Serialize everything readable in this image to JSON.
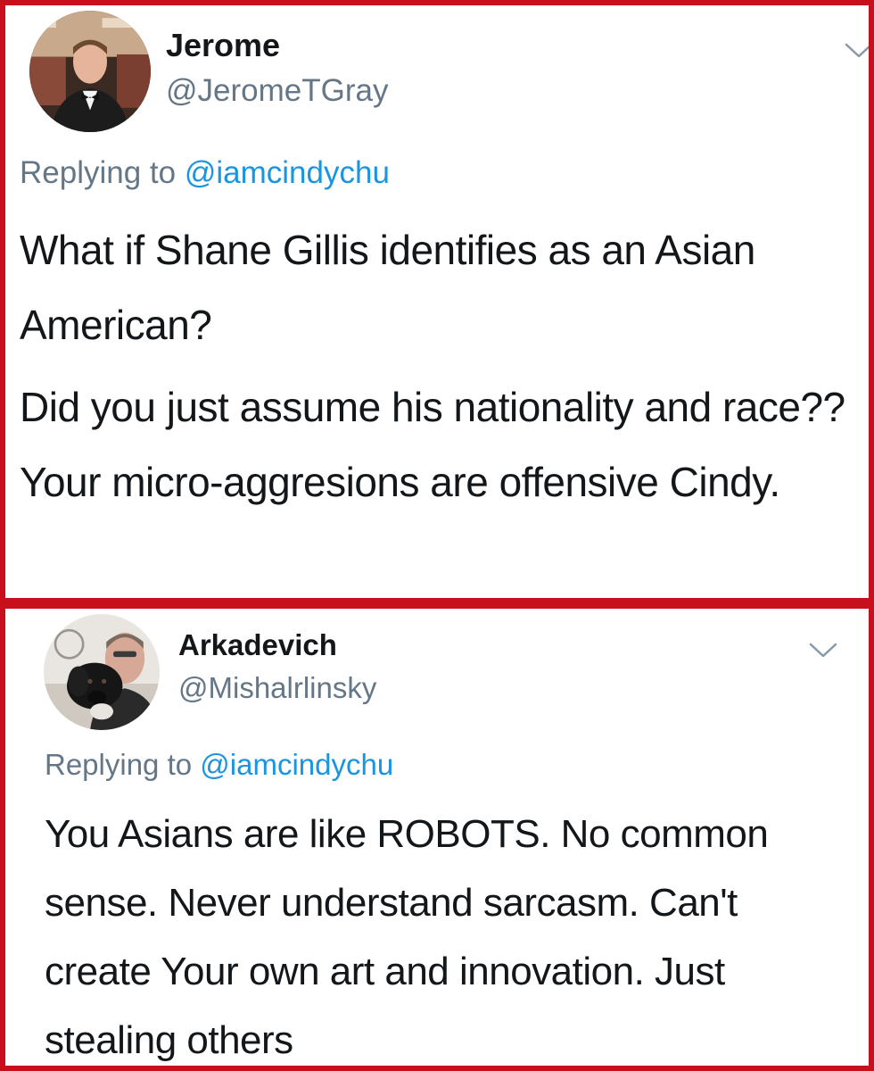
{
  "tweets": [
    {
      "display_name": "Jerome",
      "handle": "@JeromeTGray",
      "replying_to_label": "Replying to",
      "replying_to_handle": "@iamcindychu",
      "paragraphs": [
        "What if Shane Gillis identifies as an Asian American?",
        "Did you just assume his nationality and race??  Your micro-aggresions are offensive Cindy."
      ],
      "avatar_icon": "profile-photo-man-in-tuxedo",
      "menu_icon": "chevron-down-icon"
    },
    {
      "display_name": "Arkadevich",
      "handle": "@Mishalrlinsky",
      "replying_to_label": "Replying to",
      "replying_to_handle": "@iamcindychu",
      "paragraphs": [
        "You Asians are like ROBOTS. No common sense. Never understand sarcasm. Can't create Your own art and innovation. Just stealing others"
      ],
      "avatar_icon": "profile-photo-man-with-dog",
      "menu_icon": "chevron-down-icon"
    }
  ],
  "colors": {
    "frame_border": "#c8101c",
    "text_primary": "#14171a",
    "text_secondary": "#657786",
    "link": "#1b95e0"
  }
}
